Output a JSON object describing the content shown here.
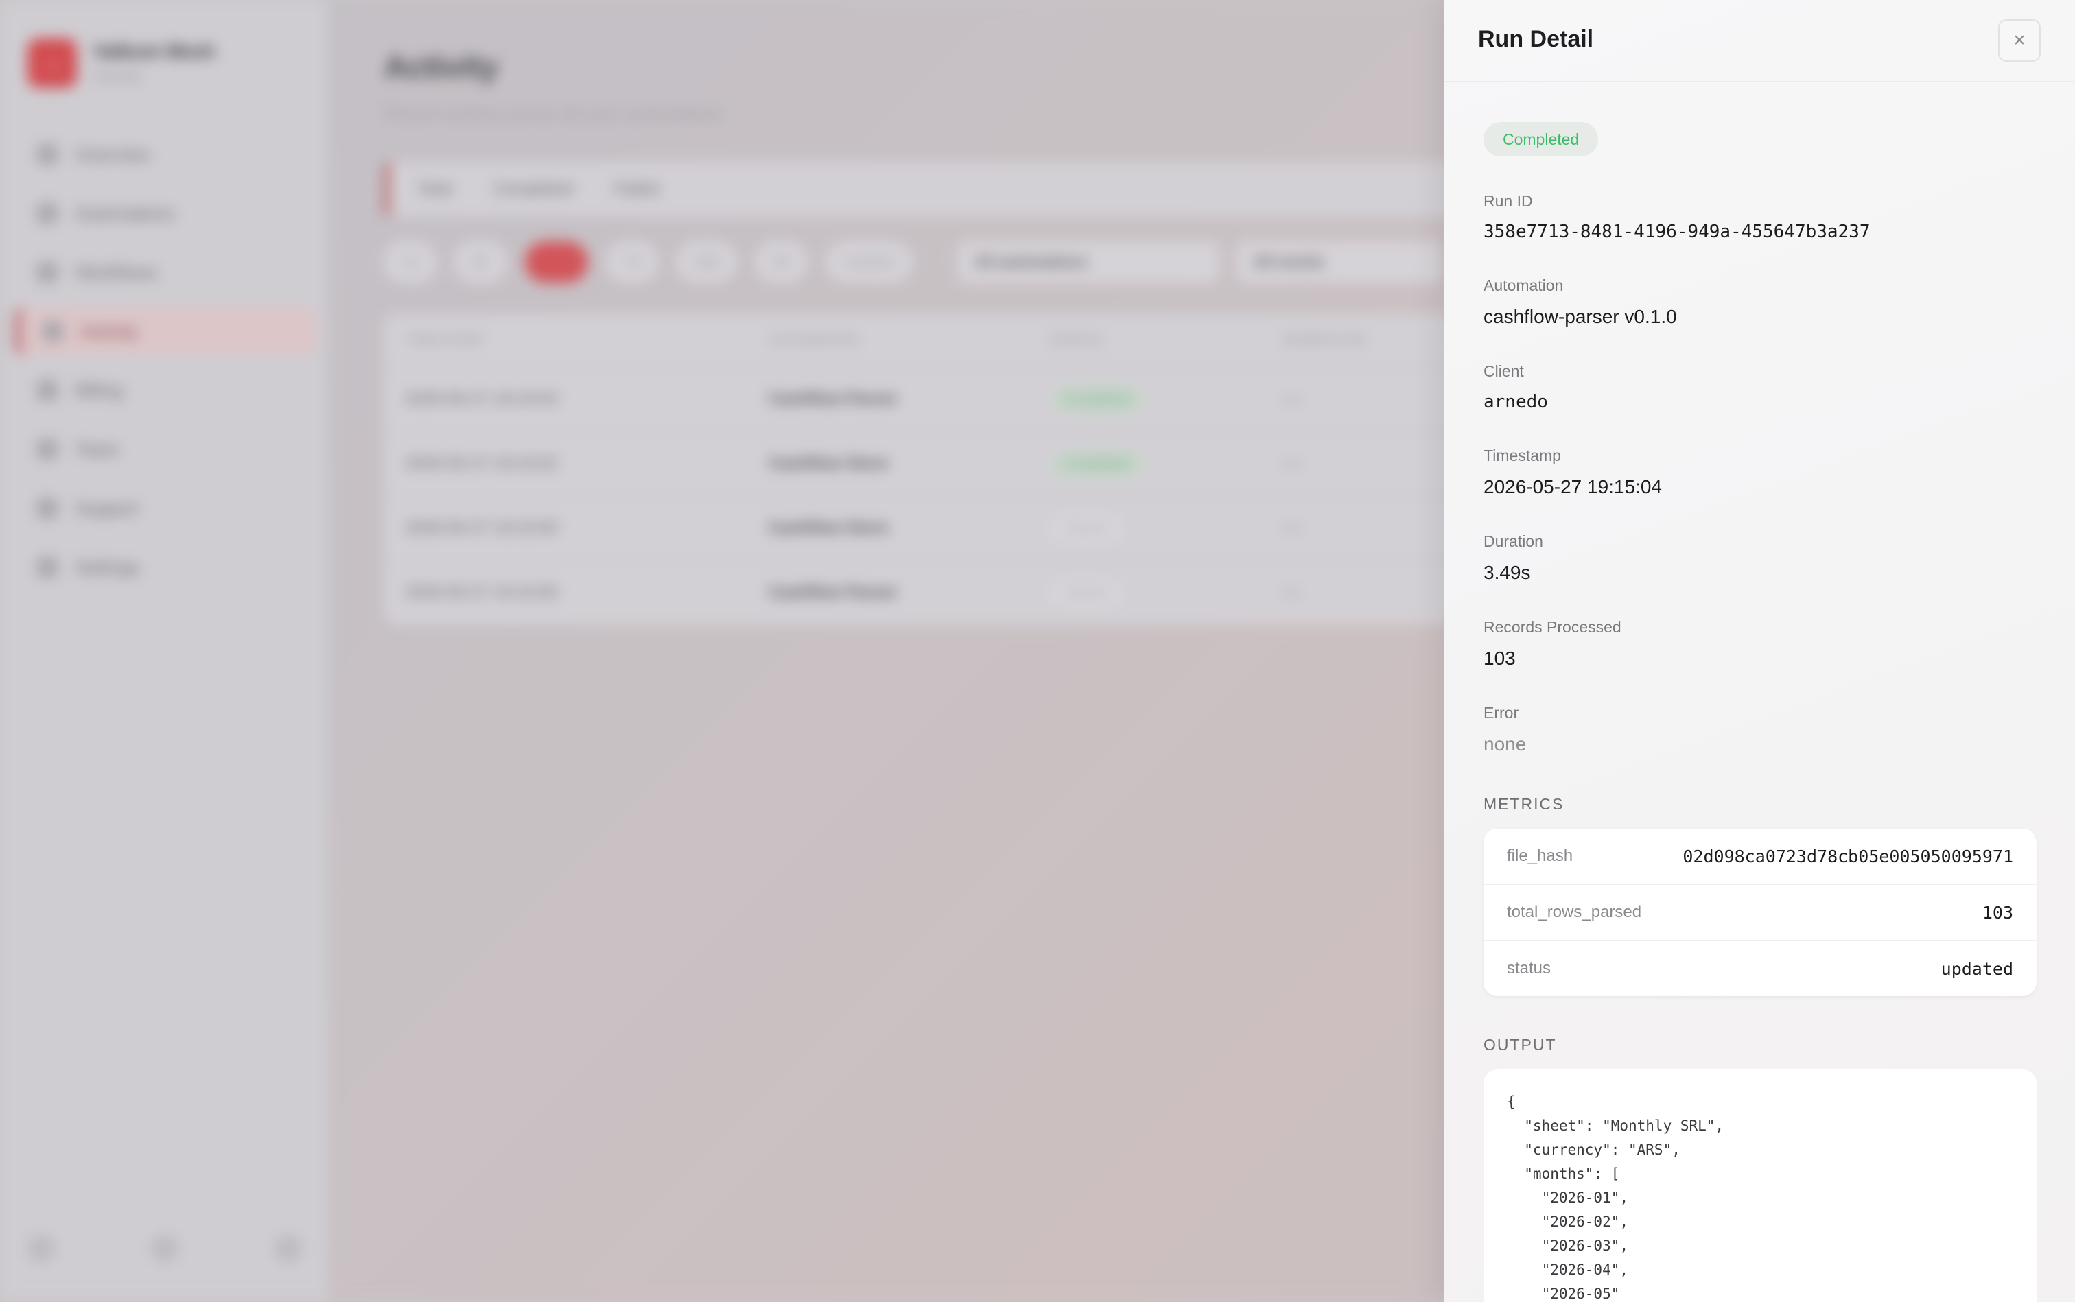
{
  "background": {
    "brand": {
      "name": "Valkom Mesh",
      "sub": "Arnedo",
      "logo_glyph": "→"
    },
    "nav": [
      {
        "label": "Overview",
        "icon": "grid-icon",
        "active": false
      },
      {
        "label": "Automations",
        "icon": "robot-icon",
        "active": false
      },
      {
        "label": "Workflows",
        "icon": "pencil-icon",
        "active": false
      },
      {
        "label": "Activity",
        "icon": "activity-icon",
        "active": true
      },
      {
        "label": "Billing",
        "icon": "card-icon",
        "active": false
      },
      {
        "label": "Team",
        "icon": "team-icon",
        "active": false
      },
      {
        "label": "Support",
        "icon": "help-icon",
        "active": false
      },
      {
        "label": "Settings",
        "icon": "gear-icon",
        "active": false
      }
    ],
    "page_title": "Activity",
    "page_subtitle": "Recent activity across all your automations",
    "stats": [
      "Total",
      "Completed",
      "Failed"
    ],
    "filters": [
      "1h",
      "6h",
      "24h",
      "7d",
      "30d",
      "All",
      "Custom"
    ],
    "selects": [
      "All automations",
      "All events"
    ],
    "table": {
      "headers": [
        "TIMESTAMP",
        "AUTOMATION",
        "STATUS",
        "WORKFLOW"
      ],
      "rows": [
        {
          "ts": "2026-05-27 19:15:04",
          "automation": "Cashflow Parser",
          "status": "Completed",
          "status_kind": "ok",
          "wf": "—"
        },
        {
          "ts": "2026-05-27 19:15:02",
          "automation": "Cashflow Store",
          "status": "Completed",
          "status_kind": "ok",
          "wf": "—"
        },
        {
          "ts": "2026-05-27 19:15:00",
          "automation": "Cashflow Store",
          "status": "Started",
          "status_kind": "grey",
          "wf": "—"
        },
        {
          "ts": "2026-05-27 19:15:00",
          "automation": "Cashflow Parser",
          "status": "Started",
          "status_kind": "grey",
          "wf": "—"
        }
      ]
    }
  },
  "panel": {
    "title": "Run Detail",
    "close_glyph": "×",
    "status_badge": "Completed",
    "fields": {
      "run_id": {
        "label": "Run ID",
        "value": "358e7713-8481-4196-949a-455647b3a237"
      },
      "automation": {
        "label": "Automation",
        "value": "cashflow-parser v0.1.0"
      },
      "client": {
        "label": "Client",
        "value": "arnedo"
      },
      "timestamp": {
        "label": "Timestamp",
        "value": "2026-05-27 19:15:04"
      },
      "duration": {
        "label": "Duration",
        "value": "3.49s"
      },
      "records": {
        "label": "Records Processed",
        "value": "103"
      },
      "error": {
        "label": "Error",
        "value": "none"
      }
    },
    "metrics_label": "METRICS",
    "metrics": [
      {
        "key": "file_hash",
        "value": "02d098ca0723d78cb05e005050095971"
      },
      {
        "key": "total_rows_parsed",
        "value": "103"
      },
      {
        "key": "status",
        "value": "updated"
      }
    ],
    "output_label": "OUTPUT",
    "output_text": "{\n  \"sheet\": \"Monthly SRL\",\n  \"currency\": \"ARS\",\n  \"months\": [\n    \"2026-01\",\n    \"2026-02\",\n    \"2026-03\",\n    \"2026-04\",\n    \"2026-05\""
  },
  "colors": {
    "accent": "#d2555a",
    "success": "#3ebd68",
    "success_bg": "#e6ebe7"
  }
}
